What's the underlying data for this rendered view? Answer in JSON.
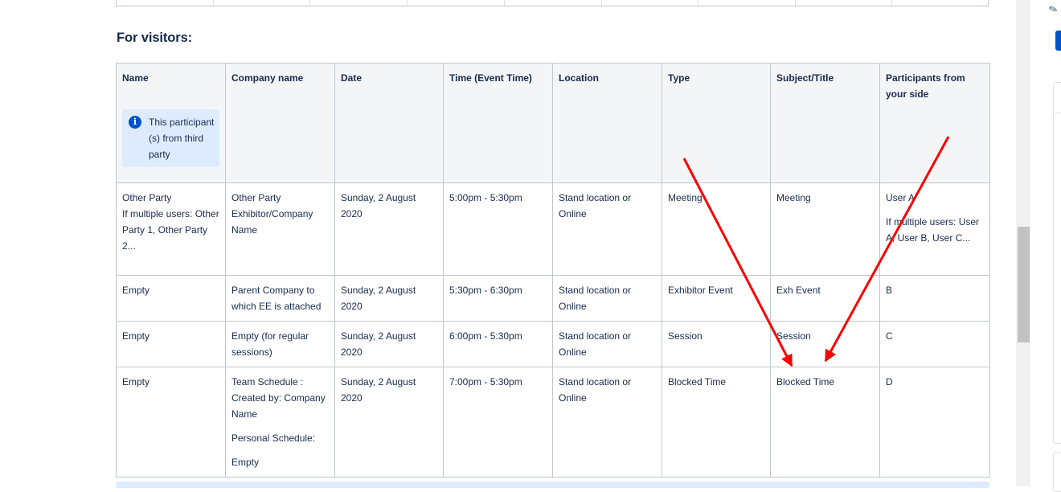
{
  "section": {
    "heading": "For visitors:"
  },
  "table": {
    "headers": [
      "Name",
      "Company name",
      "Date",
      "Time (Event Time)",
      "Location",
      "Type",
      "Subject/Title",
      "Participants from your side"
    ],
    "name_info_panel": "This participant (s) from third party",
    "rows": [
      {
        "name": [
          "Other Party",
          "If multiple users: Other Party 1, Other Party 2..."
        ],
        "company": [
          "Other Party Exhibitor/Company Name"
        ],
        "date": "Sunday, 2 August 2020",
        "time": "5:00pm - 5:30pm",
        "location": "Stand location or Online",
        "type": "Meeting",
        "subject": "Meeting",
        "participants": [
          "User A",
          "If multiple users: User A, User B, User C..."
        ]
      },
      {
        "name": [
          "Empty"
        ],
        "company": [
          "Parent Company to which EE is attached"
        ],
        "date": "Sunday, 2 August 2020",
        "time": "5:30pm - 6:30pm",
        "location": "Stand location or Online",
        "type": "Exhibitor Event",
        "subject": "Exh Event",
        "participants": [
          "B"
        ]
      },
      {
        "name": [
          "Empty"
        ],
        "company": [
          "Empty (for regular sessions)"
        ],
        "date": "Sunday, 2 August 2020",
        "time": "6:00pm - 5:30pm",
        "location": "Stand location or Online",
        "type": "Session",
        "subject": "Session",
        "participants": [
          "C"
        ]
      },
      {
        "name": [
          "Empty"
        ],
        "company": [
          "Team Schedule : Created by: Company Name",
          "Personal Schedule:",
          "Empty"
        ],
        "date": "Sunday, 2 August 2020",
        "time": "7:00pm - 5:30pm",
        "location": "Stand location or Online",
        "type": "Blocked Time",
        "subject": "Blocked Time",
        "participants": [
          "D"
        ]
      }
    ]
  },
  "icons": {
    "info": "info-icon",
    "rail": "megaphone-icon"
  },
  "colors": {
    "annotation_arrow": "#ff0000",
    "info_panel_bg": "#deebff",
    "info_icon": "#0052cc",
    "header_bg": "#f4f5f7"
  }
}
